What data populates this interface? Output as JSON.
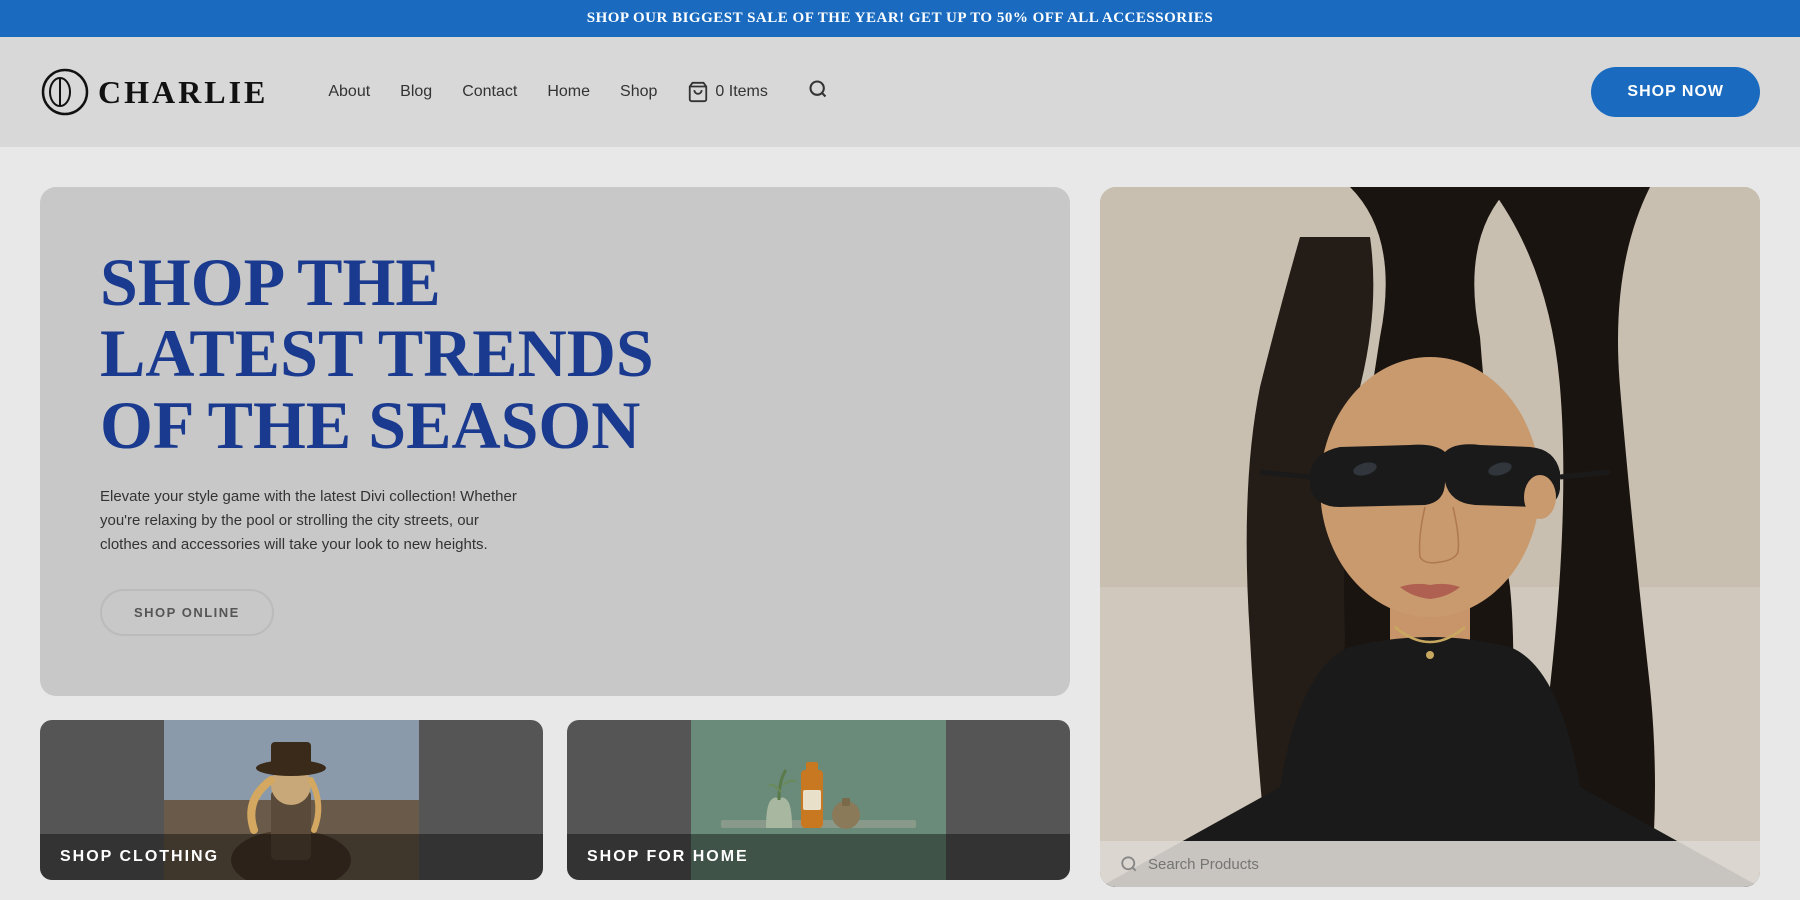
{
  "announcement": {
    "text": "SHOP OUR BIGGEST SALE OF THE YEAR! GET UP TO 50% OFF ALL ACCESSORIES"
  },
  "navbar": {
    "logo_text": "CHARLIE",
    "nav_items": [
      {
        "label": "About",
        "href": "#"
      },
      {
        "label": "Blog",
        "href": "#"
      },
      {
        "label": "Contact",
        "href": "#"
      },
      {
        "label": "Home",
        "href": "#"
      },
      {
        "label": "Shop",
        "href": "#"
      }
    ],
    "cart_label": "0 Items",
    "shop_now_label": "SHOP NOW"
  },
  "hero": {
    "headline_line1": "SHOP THE",
    "headline_line2": "LATEST TRENDS",
    "headline_line3": "OF THE SEASON",
    "description": "Elevate your style game with the latest Divi collection! Whether you're relaxing by the pool or strolling the city streets, our clothes and accessories will take your look to new heights.",
    "cta_label": "SHOP ONLINE"
  },
  "bottom_cards": [
    {
      "label": "SHOP CLOTHING"
    },
    {
      "label": "SHOP FOR HOME"
    }
  ],
  "search": {
    "placeholder": "Search Products"
  },
  "colors": {
    "accent_blue": "#1a6bbf",
    "headline_blue": "#1a3a8f",
    "announcement_bg": "#1a6bbf"
  }
}
